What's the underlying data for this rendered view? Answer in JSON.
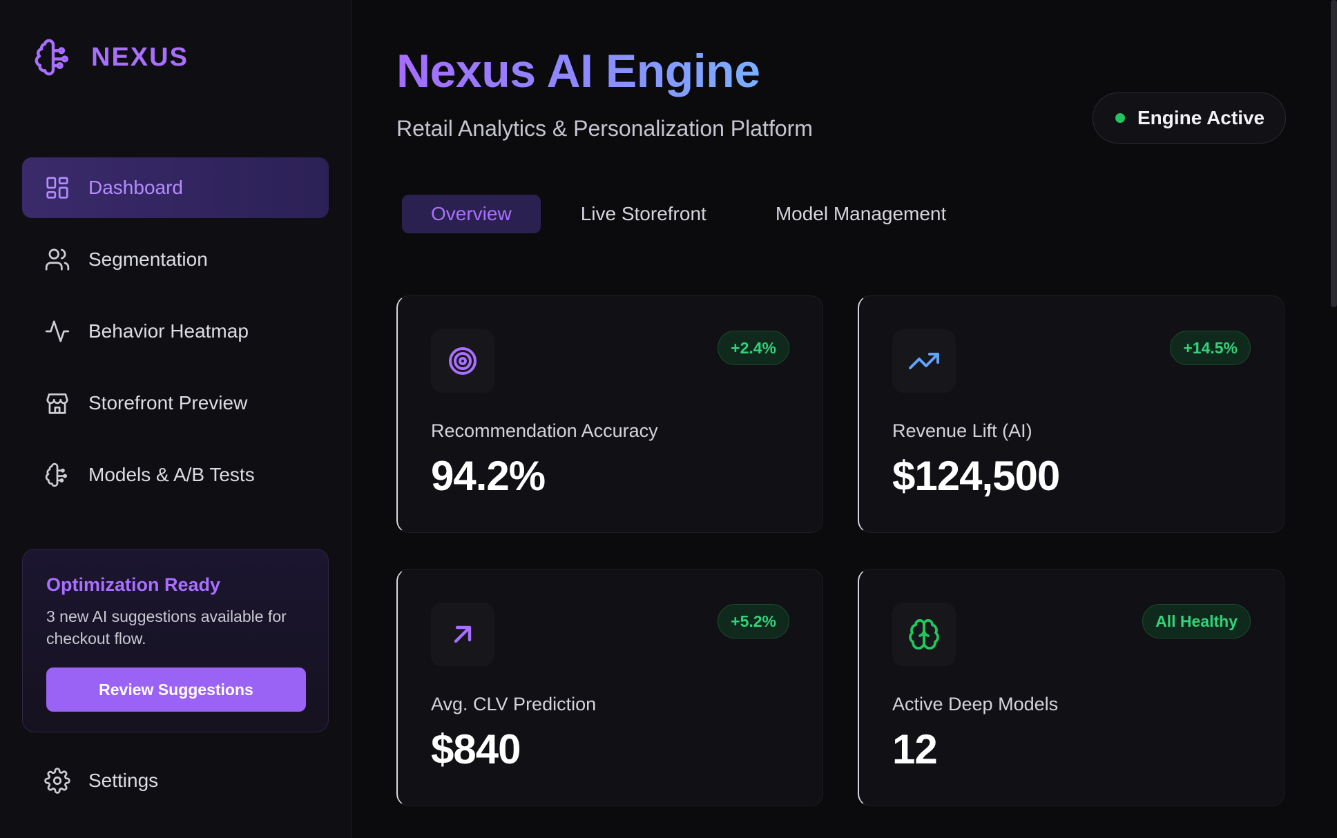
{
  "sidebar": {
    "logo_text": "NEXUS",
    "logo_icon": "brain-circuit-icon",
    "nav_items": [
      {
        "label": "Dashboard",
        "icon": "layout-grid-icon",
        "active": true
      },
      {
        "label": "Segmentation",
        "icon": "users-icon",
        "active": false
      },
      {
        "label": "Behavior Heatmap",
        "icon": "activity-icon",
        "active": false
      },
      {
        "label": "Storefront Preview",
        "icon": "store-icon",
        "active": false
      },
      {
        "label": "Models & A/B Tests",
        "icon": "brain-circuit-icon",
        "active": false
      }
    ],
    "promo": {
      "title": "Optimization Ready",
      "text": "3 new AI suggestions available for checkout flow.",
      "button_label": "Review Suggestions"
    },
    "settings_label": "Settings"
  },
  "header": {
    "title": "Nexus AI Engine",
    "subtitle": "Retail Analytics & Personalization Platform",
    "status_label": "Engine Active",
    "status_color": "#22c55e"
  },
  "tabs": [
    {
      "label": "Overview",
      "active": true
    },
    {
      "label": "Live Storefront",
      "active": false
    },
    {
      "label": "Model Management",
      "active": false
    }
  ],
  "cards": [
    {
      "label": "Recommendation Accuracy",
      "value": "94.2%",
      "badge": "+2.4%",
      "icon": "target-icon",
      "icon_color": "#a970ff"
    },
    {
      "label": "Revenue Lift (AI)",
      "value": "$124,500",
      "badge": "+14.5%",
      "icon": "trending-up-icon",
      "icon_color": "#60a5fa"
    },
    {
      "label": "Avg. CLV Prediction",
      "value": "$840",
      "badge": "+5.2%",
      "icon": "arrow-up-right-icon",
      "icon_color": "#a970ff"
    },
    {
      "label": "Active Deep Models",
      "value": "12",
      "badge": "All Healthy",
      "icon": "brain-icon",
      "icon_color": "#22c55e"
    }
  ],
  "colors": {
    "accent": "#a970ff",
    "positive": "#33d27a",
    "background": "#0b0b0e"
  }
}
